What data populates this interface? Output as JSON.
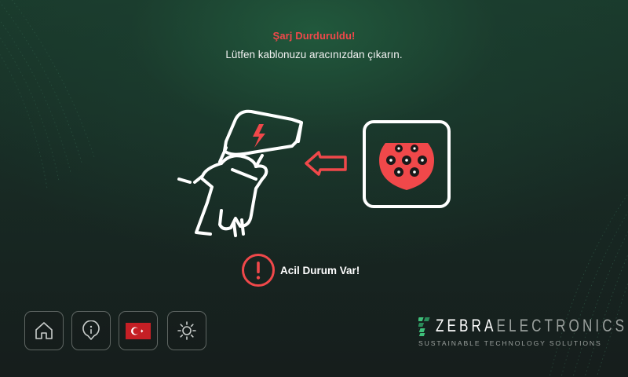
{
  "status": {
    "title": "Şarj Durduruldu!",
    "message": "Lütfen kablonuzu aracınızdan çıkarın."
  },
  "alert": {
    "text": "Acil Durum Var!",
    "icon": "alert-circle-icon"
  },
  "illustration": {
    "plug_icon": "hand-holding-plug-icon",
    "arrow_icon": "arrow-left-icon",
    "socket_icon": "type2-socket-icon"
  },
  "nav": {
    "buttons": [
      {
        "name": "home-button",
        "icon": "home-icon"
      },
      {
        "name": "info-button",
        "icon": "info-icon"
      },
      {
        "name": "language-button",
        "icon": "turkey-flag-icon"
      },
      {
        "name": "brightness-button",
        "icon": "sun-icon"
      }
    ]
  },
  "brand": {
    "name_part1": "ZEBRA",
    "name_part2": "ELECTRONICS",
    "tagline": "SUSTAINABLE TECHNOLOGY SOLUTIONS"
  },
  "colors": {
    "accent_red": "#f0484a",
    "background_top": "#1e4a36",
    "background_bottom": "#161d1c",
    "button_border": "#5f6663",
    "brand_green": "#3fbf7a"
  }
}
